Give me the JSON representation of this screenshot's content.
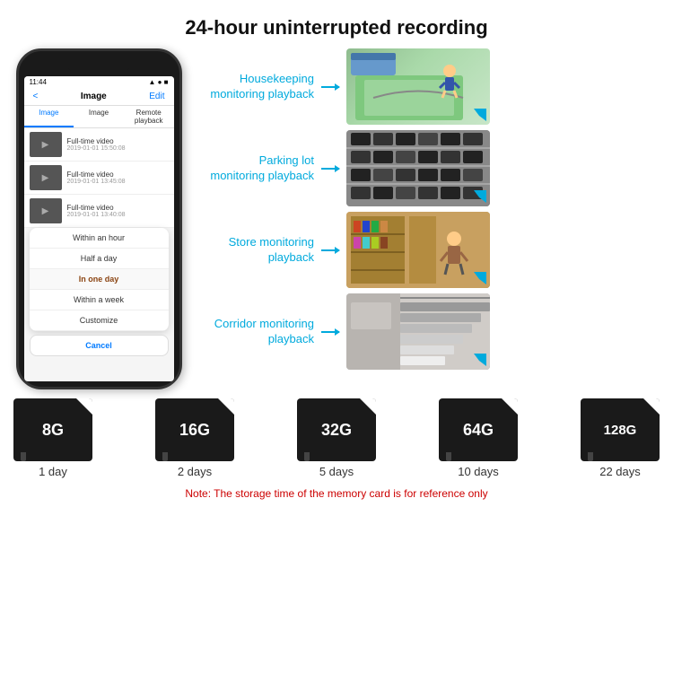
{
  "header": {
    "title": "24-hour uninterrupted recording"
  },
  "phone": {
    "time": "11:44",
    "nav": {
      "back": "<",
      "title": "Image",
      "edit": "Edit"
    },
    "tabs": [
      "Image",
      "Image",
      "Remote playback"
    ],
    "videos": [
      {
        "title": "Full-time video",
        "date": "2019-01-01 15:50:08"
      },
      {
        "title": "Full-time video",
        "date": "2019-01-01 13:45:08"
      },
      {
        "title": "Full-time video",
        "date": "2019-01-01 13:40:08"
      }
    ],
    "dropdown": {
      "items": [
        {
          "label": "Within an hour",
          "selected": false
        },
        {
          "label": "Half a day",
          "selected": false
        },
        {
          "label": "In one day",
          "selected": true
        },
        {
          "label": "Within a week",
          "selected": false
        },
        {
          "label": "Customize",
          "selected": false
        }
      ],
      "cancel": "Cancel"
    }
  },
  "monitoring": {
    "items": [
      {
        "label": "Housekeeping\nmonitoring playback",
        "img_type": "child"
      },
      {
        "label": "Parking lot\nmonitoring playback",
        "img_type": "parking"
      },
      {
        "label": "Store monitoring\nplayback",
        "img_type": "store"
      },
      {
        "label": "Corridor monitoring\nplayback",
        "img_type": "corridor"
      }
    ]
  },
  "storage": {
    "cards": [
      {
        "size": "8G",
        "days": "1 day"
      },
      {
        "size": "16G",
        "days": "2 days"
      },
      {
        "size": "32G",
        "days": "5 days"
      },
      {
        "size": "64G",
        "days": "10 days"
      },
      {
        "size": "128G",
        "days": "22 days"
      }
    ],
    "note": "Note: The storage time of the memory card is for reference only"
  }
}
